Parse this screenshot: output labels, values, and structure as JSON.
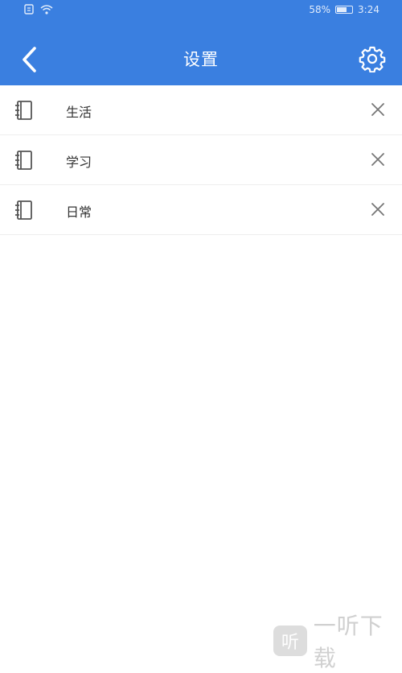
{
  "statusbar": {
    "battery": "58%",
    "time": "3:24"
  },
  "header": {
    "title": "设置"
  },
  "list": {
    "items": [
      {
        "label": "生活"
      },
      {
        "label": "学习"
      },
      {
        "label": "日常"
      }
    ]
  },
  "watermark": {
    "badge": "听",
    "text": "一听下载"
  },
  "colors": {
    "primary": "#3a7fe0",
    "text": "#333333",
    "icon": "#555555"
  }
}
